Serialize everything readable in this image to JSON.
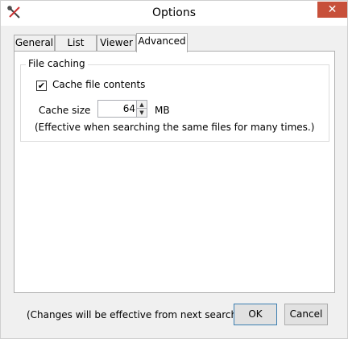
{
  "window": {
    "title": "Options",
    "close_glyph": "✕"
  },
  "tabs": [
    {
      "label": "General",
      "active": false
    },
    {
      "label": "List",
      "active": false
    },
    {
      "label": "Viewer",
      "active": false
    },
    {
      "label": "Advanced",
      "active": true
    }
  ],
  "advanced": {
    "group_title": "File caching",
    "cache_contents_label": "Cache file contents",
    "cache_contents_checked": true,
    "checkbox_glyph": "✔",
    "cache_size_label": "Cache size",
    "cache_size_value": "64",
    "spin_up_glyph": "▲",
    "spin_down_glyph": "▼",
    "unit": "MB",
    "note": "(Effective when searching the same files for many times.)"
  },
  "footer": {
    "note": "(Changes will be effective from next search.)",
    "ok_label": "OK",
    "cancel_label": "Cancel"
  }
}
